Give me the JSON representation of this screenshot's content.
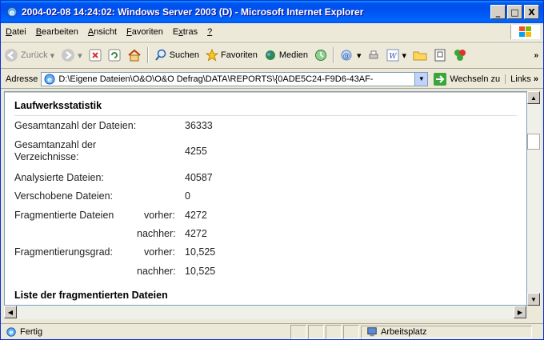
{
  "window": {
    "title": "2004-02-08 14:24:02: Windows Server 2003 (D) - Microsoft Internet Explorer"
  },
  "window_buttons": {
    "minimize": "_",
    "maximize": "□",
    "close": "X"
  },
  "menu": [
    "Datei",
    "Bearbeiten",
    "Ansicht",
    "Favoriten",
    "Extras",
    "?"
  ],
  "menu_accel": [
    "D",
    "B",
    "A",
    "F",
    "x",
    "?"
  ],
  "toolbar": {
    "back": "Zurück",
    "search": "Suchen",
    "favorites": "Favoriten",
    "media": "Medien",
    "overflow": "»"
  },
  "address": {
    "label": "Adresse",
    "value": "D:\\Eigene Dateien\\O&O\\O&O Defrag\\DATA\\REPORTS\\{0ADE5C24-F9D6-43AF-",
    "go": "Wechseln zu",
    "links": "Links"
  },
  "report": {
    "title": "Laufwerksstatistik",
    "rows": [
      {
        "label": "Gesamtanzahl der Dateien:",
        "sub": "",
        "value": "36333"
      },
      {
        "label": "Gesamtanzahl der Verzeichnisse:",
        "sub": "",
        "value": "4255"
      },
      {
        "label": "Analysierte Dateien:",
        "sub": "",
        "value": "40587"
      },
      {
        "label": "Verschobene Dateien:",
        "sub": "",
        "value": "0"
      },
      {
        "label": "Fragmentierte Dateien",
        "sub": "vorher:",
        "value": "4272"
      },
      {
        "label": "",
        "sub": "nachher:",
        "value": "4272"
      },
      {
        "label": "Fragmentierungsgrad:",
        "sub": "vorher:",
        "value": "10,525"
      },
      {
        "label": "",
        "sub": "nachher:",
        "value": "10,525"
      }
    ],
    "list_title": "Liste der fragmentierten Dateien"
  },
  "status": {
    "text": "Fertig",
    "zone": "Arbeitsplatz"
  },
  "colors": {
    "titlebar": "#0054E3",
    "chrome": "#ECE9D8",
    "border": "#7F9DB9"
  }
}
